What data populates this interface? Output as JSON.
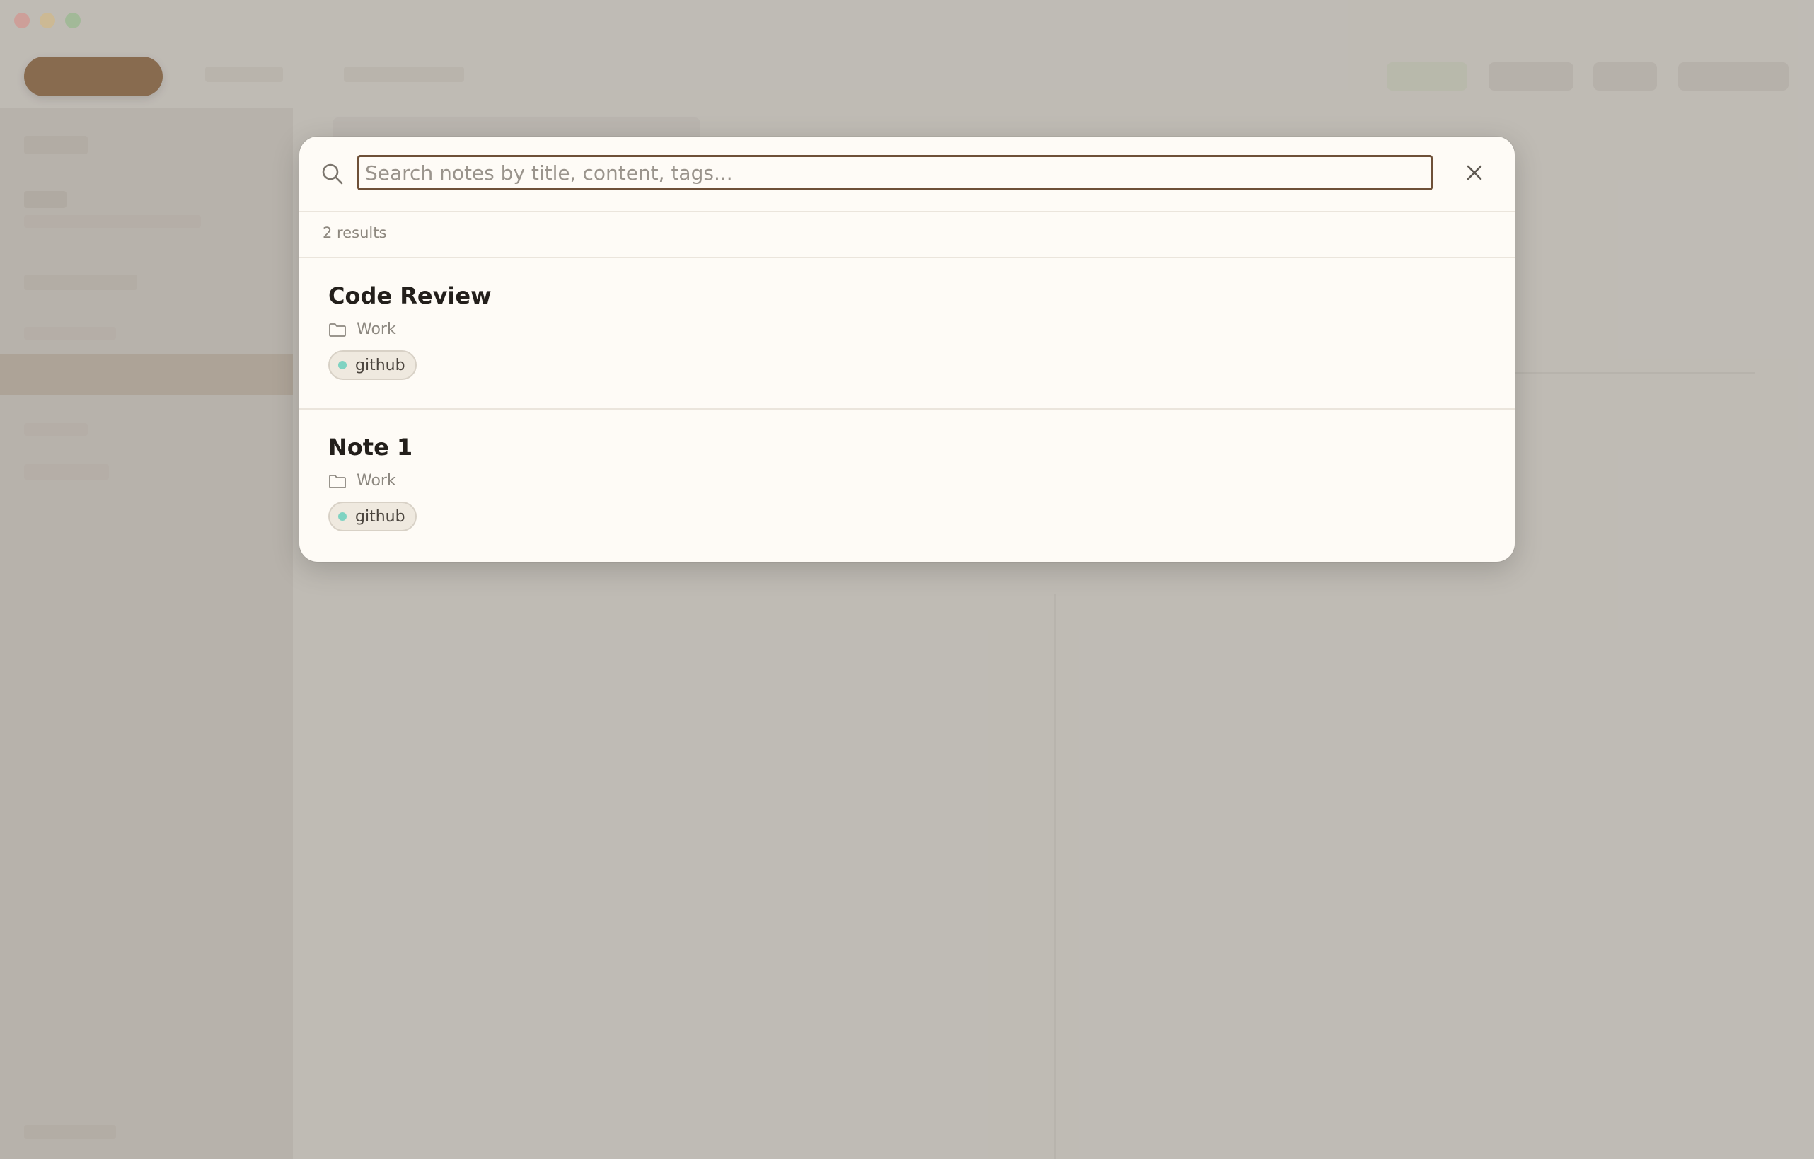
{
  "search": {
    "placeholder": "Search notes by title, content, tags...",
    "value": ""
  },
  "results": {
    "count_label": "2 results",
    "items": [
      {
        "title": "Code Review",
        "folder": "Work",
        "tag": "github",
        "tag_color": "#7fd3c2"
      },
      {
        "title": "Note 1",
        "folder": "Work",
        "tag": "github",
        "tag_color": "#7fd3c2"
      }
    ]
  },
  "colors": {
    "accent": "#6e5038",
    "modal_background": "#fefbf6",
    "backdrop": "#c9c5bf"
  },
  "icons": {
    "search": "search-icon",
    "close": "close-icon",
    "folder": "folder-icon"
  }
}
